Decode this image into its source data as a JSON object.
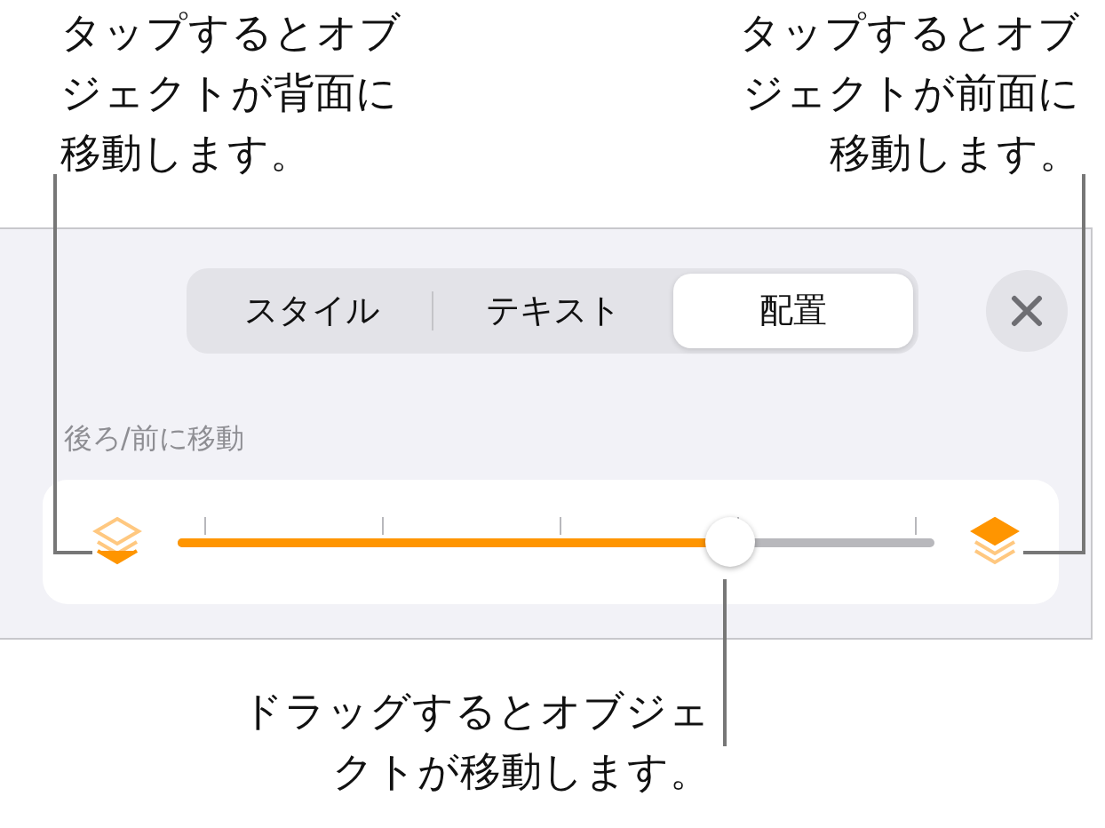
{
  "callouts": [
    "タップするとオブジェクトが背面に移動します。",
    "タップするとオブジェクトが前面に移動します。"
  ],
  "tabs": [
    {
      "label": "スタイル",
      "selected": false
    },
    {
      "label": "テキスト",
      "selected": false
    },
    {
      "label": "配置",
      "selected": true
    }
  ],
  "section_label": "後ろ/前に移動",
  "slider": {
    "level": 0.73
  },
  "bottom_callout": "ドラッグするとオブジェクトが移動します。"
}
